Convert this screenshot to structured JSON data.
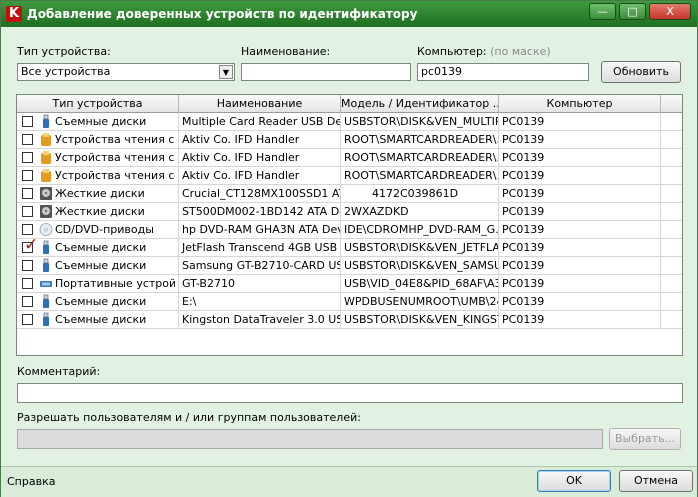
{
  "window": {
    "title": "Добавление доверенных устройств по идентификатору",
    "app_icon_letter": "K",
    "minimize_glyph": "—",
    "maximize_glyph": "□",
    "close_glyph": "X",
    "accent_color": "#2e8b32"
  },
  "filters": {
    "device_type_label": "Тип устройства:",
    "device_type_value": "Все устройства",
    "name_label": "Наименование:",
    "name_value": "",
    "computer_label": "Компьютер:",
    "computer_hint": "(по маске)",
    "computer_value": "pc0139",
    "refresh_button": "Обновить"
  },
  "table": {
    "columns": [
      "Тип устройства",
      "Наименование",
      "Модель / Идентификатор ...",
      "Компьютер"
    ],
    "rows": [
      {
        "checked": false,
        "icon": "usb-stick-icon",
        "type": "Съемные диски",
        "name": "Multiple Card  Reader USB De...",
        "model": "USBSTOR\\DISK&VEN_MULTIP...",
        "computer": "PC0139"
      },
      {
        "checked": false,
        "icon": "smartcard-reader-icon",
        "type": "Устройства чтения с...",
        "name": "Aktiv Co. IFD Handler",
        "model": "ROOT\\SMARTCARDREADER\\...",
        "computer": "PC0139"
      },
      {
        "checked": false,
        "icon": "smartcard-reader-icon",
        "type": "Устройства чтения с...",
        "name": "Aktiv Co. IFD Handler",
        "model": "ROOT\\SMARTCARDREADER\\...",
        "computer": "PC0139"
      },
      {
        "checked": false,
        "icon": "smartcard-reader-icon",
        "type": "Устройства чтения с...",
        "name": "Aktiv Co. IFD Handler",
        "model": "ROOT\\SMARTCARDREADER\\...",
        "computer": "PC0139"
      },
      {
        "checked": false,
        "icon": "hard-disk-icon",
        "type": "Жесткие диски",
        "name": "Crucial_CT128MX100SSD1 AT...",
        "model": "        4172C039861D",
        "computer": "PC0139"
      },
      {
        "checked": false,
        "icon": "hard-disk-icon",
        "type": "Жесткие диски",
        "name": "ST500DM002-1BD142 ATA De...",
        "model": "2WXAZDKD",
        "computer": "PC0139"
      },
      {
        "checked": false,
        "icon": "cd-dvd-icon",
        "type": "CD/DVD-приводы",
        "name": "hp DVD-RAM GHA3N ATA Devi...",
        "model": "IDE\\CDROMHP_DVD-RAM_G...",
        "computer": "PC0139"
      },
      {
        "checked": true,
        "icon": "usb-stick-icon",
        "type": "Съемные диски",
        "name": "JetFlash Transcend 4GB USB ...",
        "model": "USBSTOR\\DISK&VEN_JETFLA...",
        "computer": "PC0139"
      },
      {
        "checked": false,
        "icon": "usb-stick-icon",
        "type": "Съемные диски",
        "name": "Samsung GT-B2710-CARD US...",
        "model": "USBSTOR\\DISK&VEN_SAMSU...",
        "computer": "PC0139"
      },
      {
        "checked": false,
        "icon": "portable-device-icon",
        "type": "Портативные устрой...",
        "name": "GT-B2710",
        "model": "USB\\VID_04E8&PID_68AF\\A3...",
        "computer": "PC0139"
      },
      {
        "checked": false,
        "icon": "usb-stick-icon",
        "type": "Съемные диски",
        "name": "E:\\",
        "model": "WPDBUSENUMROOT\\UMB\\2&...",
        "computer": "PC0139"
      },
      {
        "checked": false,
        "icon": "usb-stick-icon",
        "type": "Съемные диски",
        "name": "Kingston DataTraveler 3.0 US...",
        "model": "USBSTOR\\DISK&VEN_KINGST...",
        "computer": "PC0139"
      }
    ]
  },
  "comment": {
    "label": "Комментарий:",
    "value": ""
  },
  "allow": {
    "label": "Разрешать пользователям и / или группам пользователей:",
    "value": "",
    "select_button": "Выбрать..."
  },
  "footer": {
    "help_link": "Справка",
    "ok_button": "OK",
    "cancel_button": "Отмена"
  }
}
